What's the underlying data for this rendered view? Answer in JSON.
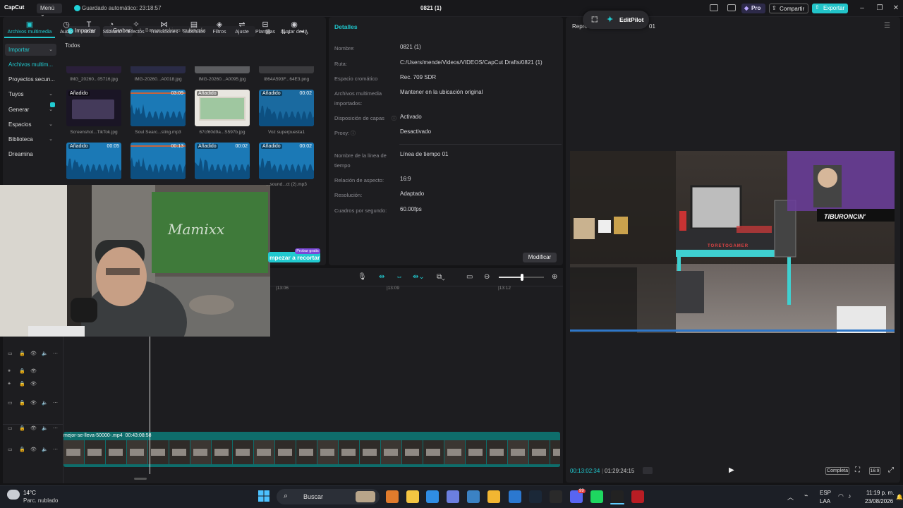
{
  "titlebar": {
    "logo": "CapCut",
    "menu": "Menú",
    "autosave": "Guardado automático: 23:18:57",
    "title": "0821 (1)",
    "pro": "Pro",
    "share": "Compartir",
    "export": "Exportar"
  },
  "toolbar": {
    "tools": [
      "Archivos multimedia",
      "Audio",
      "Texto",
      "Stickers",
      "Efectos",
      "Transiciones",
      "Subtítulos",
      "Filtros",
      "Ajuste",
      "Plantillas",
      "Avatar de IA"
    ],
    "icons": [
      "folder-icon",
      "audio-icon",
      "text-icon",
      "sticker-icon",
      "effects-icon",
      "transitions-icon",
      "subtitles-icon",
      "filters-icon",
      "adjust-icon",
      "templates-icon",
      "avatar-icon"
    ]
  },
  "sidebar": {
    "items": [
      "Importar",
      "Archivos multim...",
      "Proyectos secun...",
      "Tuyos",
      "Generar",
      "Espacios",
      "Biblioteca",
      "Dreamina"
    ]
  },
  "media": {
    "import": "Importar",
    "record": "Grabar",
    "search_placeholder": "Buscar archivos multimedia",
    "filter_label": "Todos",
    "row0": [
      "IMG_20260...05716.jpg",
      "IMG-20260...A0018.jpg",
      "IMG-20260...A0095.jpg",
      "I864A593F...64E3.png"
    ],
    "row1": [
      {
        "badge": "Añadido",
        "dur": "",
        "name": "Screenshot...TikTok.jpg"
      },
      {
        "badge": "",
        "dur": "03:09",
        "name": "Soul Searc...sting.mp3"
      },
      {
        "badge": "Añadido",
        "dur": "",
        "name": "67cf60d9a...S597b.jpg"
      },
      {
        "badge": "Añadido",
        "dur": "00:02",
        "name": "Voz superpuesta1"
      }
    ],
    "row2": [
      {
        "badge": "Añadido",
        "dur": "00:05"
      },
      {
        "badge": "",
        "dur": "00:13"
      },
      {
        "badge": "Añadido",
        "dur": "00:02"
      },
      {
        "badge": "Añadido",
        "dur": "00:02",
        "name": "...sound...ct (2).mp3"
      }
    ],
    "try_label": "mpezar a recortar",
    "try_badge": "Probar gratis"
  },
  "details": {
    "title": "Detalles",
    "fields": [
      {
        "label": "Nombre:",
        "value": "0821 (1)"
      },
      {
        "label": "Ruta:",
        "value": "C:/Users/mende/Videos/VIDEOS/CapCut Drafts/0821 (1)"
      },
      {
        "label": "Espacio cromático",
        "value": "Rec. 709 SDR"
      },
      {
        "label": "Archivos multimedia importados:",
        "value": "Mantener en la ubicación original"
      },
      {
        "label": "Disposición de capas",
        "value": "Activado"
      },
      {
        "label": "Proxy:",
        "value": "Desactivado"
      },
      {
        "label": "Nombre de la línea de tiempo",
        "value": "Línea de tiempo 01"
      },
      {
        "label": "Relación de aspecto:",
        "value": "16:9"
      },
      {
        "label": "Resolución:",
        "value": "Adaptado"
      },
      {
        "label": "Cuadros por segundo:",
        "value": "60.00fps"
      }
    ],
    "modify": "Modificar"
  },
  "player": {
    "header": "Repro",
    "header2": "01",
    "editpilot": "EditPilot",
    "time_current": "00:13:02:34",
    "time_total": "01:29:24:15",
    "completa": "Completa",
    "ratio": "16:9",
    "overlay_text1": "TIBURONCIN'",
    "overlay_text2": "TORETOGAMER"
  },
  "timeline": {
    "ruler": [
      "|13:06",
      "|13:09",
      "|13:12"
    ],
    "clip_name": "mejor-se-lleva-50000-.mp4",
    "clip_dur": "00:43:08:58",
    "progress": 0.146
  },
  "taskbar": {
    "temp": "14°C",
    "weather": "Parc. nublado",
    "search": "Buscar",
    "lang1": "ESP",
    "lang2": "LAA",
    "time": "11:19 p. m.",
    "date": "23/08/2026",
    "badge_count": "99"
  },
  "colors": {
    "accent": "#21cbd1",
    "bg": "#141416",
    "panel": "#1d1d20",
    "clip": "#0e6d6b"
  }
}
